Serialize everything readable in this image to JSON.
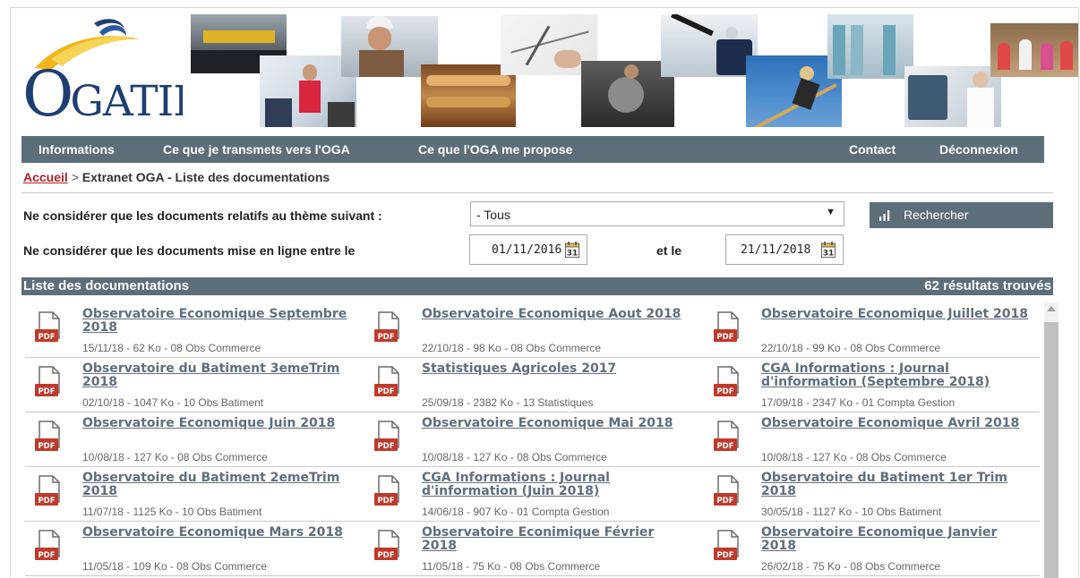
{
  "logo": {
    "text_big": "O",
    "text_rest": "GATIL"
  },
  "nav": {
    "informations": "Informations",
    "transmets": "Ce que je transmets vers l'OGA",
    "propose": "Ce que l'OGA me propose",
    "contact": "Contact",
    "deconnexion": "Déconnexion"
  },
  "breadcrumb": {
    "home": "Accueil",
    "separator": ">",
    "current": "Extranet OGA - Liste des documentations"
  },
  "filters": {
    "theme_label": "Ne considérer que les documents relatifs au thème suivant :",
    "theme_value": "- Tous",
    "date_label": "Ne considérer que les documents mise en ligne entre le",
    "date_from": "01/11/2016",
    "and_label": "et le",
    "date_to": "21/11/2018",
    "search_label": "Rechercher"
  },
  "list": {
    "title": "Liste des documentations",
    "count": "62 résultats trouvés",
    "items": [
      {
        "title": "Observatoire Economique Septembre 2018",
        "meta": "15/11/18 - 62 Ko - 08 Obs Commerce"
      },
      {
        "title": "Observatoire Economique Aout 2018",
        "meta": "22/10/18 - 98 Ko - 08 Obs Commerce"
      },
      {
        "title": "Observatoire Economique Juillet 2018",
        "meta": "22/10/18 - 99 Ko - 08 Obs Commerce"
      },
      {
        "title": "Observatoire du Batiment 3emeTrim 2018",
        "meta": "02/10/18 - 1047 Ko - 10 Obs Batiment"
      },
      {
        "title": "Statistiques Agricoles 2017",
        "meta": "25/09/18 - 2382 Ko - 13 Statistiques"
      },
      {
        "title": "CGA Informations : Journal d'information (Septembre 2018)",
        "meta": "17/09/18 - 2347 Ko - 01 Compta Gestion"
      },
      {
        "title": "Observatoire Economique Juin 2018",
        "meta": "10/08/18 - 127 Ko - 08 Obs Commerce"
      },
      {
        "title": "Observatoire Economique Mai 2018",
        "meta": "10/08/18 - 127 Ko - 08 Obs Commerce"
      },
      {
        "title": "Observatoire Economique Avril 2018",
        "meta": "10/08/18 - 127 Ko - 08 Obs Commerce"
      },
      {
        "title": "Observatoire du Batiment 2emeTrim 2018",
        "meta": "11/07/18 - 1125 Ko - 10 Obs Batiment"
      },
      {
        "title": "CGA Informations : Journal d'information (Juin 2018)",
        "meta": "14/06/18 - 907 Ko - 01 Compta Gestion"
      },
      {
        "title": "Observatoire du Batiment 1er Trim 2018",
        "meta": "30/05/18 - 1127 Ko - 10 Obs Batiment"
      },
      {
        "title": "Observatoire Economique Mars 2018",
        "meta": "11/05/18 - 109 Ko - 08 Obs Commerce"
      },
      {
        "title": "Observatoire Econimique Février 2018",
        "meta": "11/05/18 - 75 Ko - 08 Obs Commerce"
      },
      {
        "title": "Observatoire Economique Janvier 2018",
        "meta": "26/02/18 - 75 Ko - 08 Obs Commerce"
      }
    ]
  },
  "pdf_label": "PDF",
  "calendar_day": "31",
  "colors": {
    "nav": "#5c6e7a",
    "link": "#5f6e7e",
    "pdf_red": "#c0392b",
    "breadcrumb_link": "#b31f24"
  }
}
